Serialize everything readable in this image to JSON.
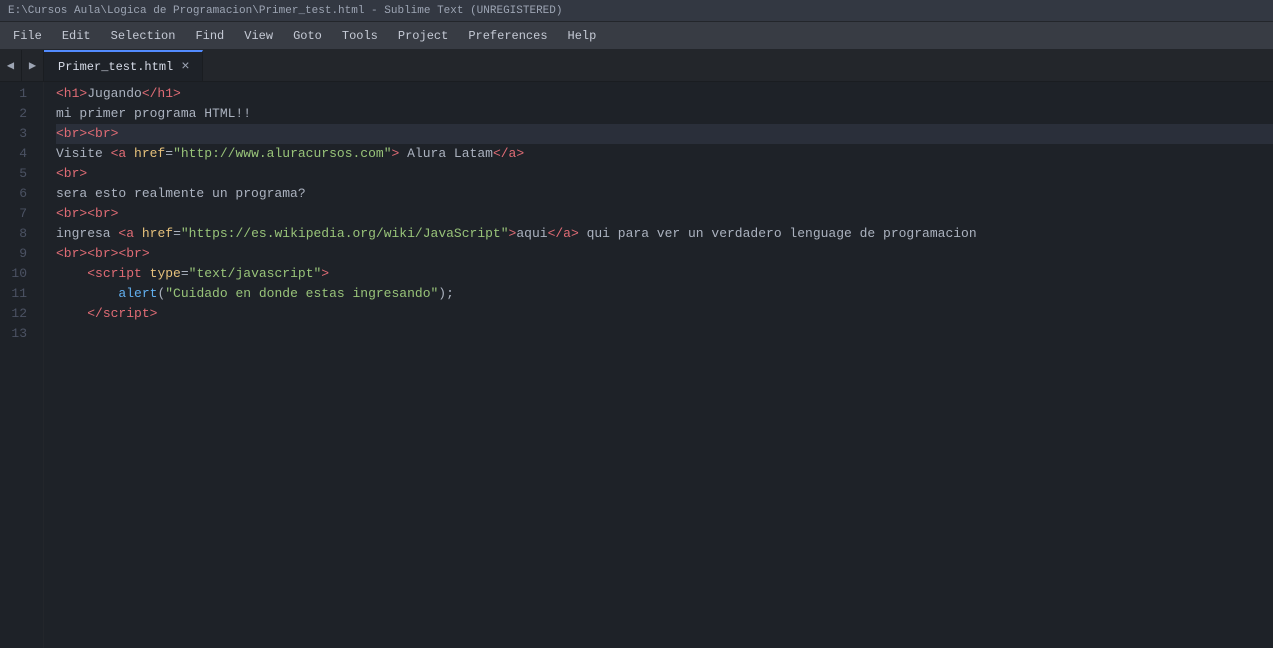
{
  "titleBar": {
    "text": "E:\\Cursos Aula\\Logica de Programacion\\Primer_test.html - Sublime Text (UNREGISTERED)"
  },
  "menuBar": {
    "items": [
      "File",
      "Edit",
      "Selection",
      "Find",
      "View",
      "Goto",
      "Tools",
      "Project",
      "Preferences",
      "Help"
    ]
  },
  "tab": {
    "name": "Primer_test.html",
    "close": "×"
  },
  "tabNav": {
    "left": "◀",
    "right": "▶"
  },
  "lineNumbers": [
    1,
    2,
    3,
    4,
    5,
    6,
    7,
    8,
    9,
    10,
    11,
    12,
    13
  ],
  "code": {
    "lines": [
      {
        "id": 1,
        "highlight": false
      },
      {
        "id": 2,
        "highlight": false
      },
      {
        "id": 3,
        "highlight": true
      },
      {
        "id": 4,
        "highlight": false
      },
      {
        "id": 5,
        "highlight": false
      },
      {
        "id": 6,
        "highlight": false
      },
      {
        "id": 7,
        "highlight": false
      },
      {
        "id": 8,
        "highlight": false
      },
      {
        "id": 9,
        "highlight": false
      },
      {
        "id": 10,
        "highlight": false
      },
      {
        "id": 11,
        "highlight": false
      },
      {
        "id": 12,
        "highlight": false
      },
      {
        "id": 13,
        "highlight": false
      }
    ]
  }
}
